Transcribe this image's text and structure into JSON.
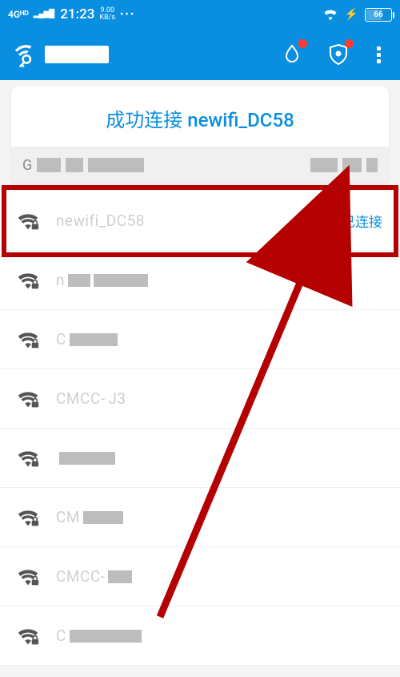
{
  "statusbar": {
    "network_type": "4Gᴴᴰ",
    "time": "21:23",
    "speed_value": "9.00",
    "speed_unit": "KB/s",
    "battery_percent": "66"
  },
  "header": {
    "water_badge": true,
    "shield_badge": true
  },
  "banner": {
    "connected_prefix": "成功连接 ",
    "connected_ssid": "newifi_DC58"
  },
  "connected_status_label": "已连接",
  "networks": [
    {
      "ssid": "newifi_DC58",
      "connected": true,
      "censors": []
    },
    {
      "ssid": "n",
      "connected": false,
      "censors": [
        28,
        68
      ],
      "tail": ""
    },
    {
      "ssid": "C",
      "connected": false,
      "censors": [
        60
      ],
      "tail": ""
    },
    {
      "ssid": "CMCC-",
      "connected": false,
      "censors": [],
      "tail": "J3"
    },
    {
      "ssid": "",
      "connected": false,
      "censors": [
        70
      ],
      "tail": ""
    },
    {
      "ssid": "CM",
      "connected": false,
      "censors": [
        50
      ],
      "tail": ""
    },
    {
      "ssid": "CMCC-",
      "connected": false,
      "censors": [
        30
      ],
      "tail": ""
    },
    {
      "ssid": "C",
      "connected": false,
      "censors": [
        90
      ],
      "tail": ""
    }
  ],
  "colors": {
    "brand_blue": "#0a8fe0",
    "highlight_red": "#b40000"
  }
}
